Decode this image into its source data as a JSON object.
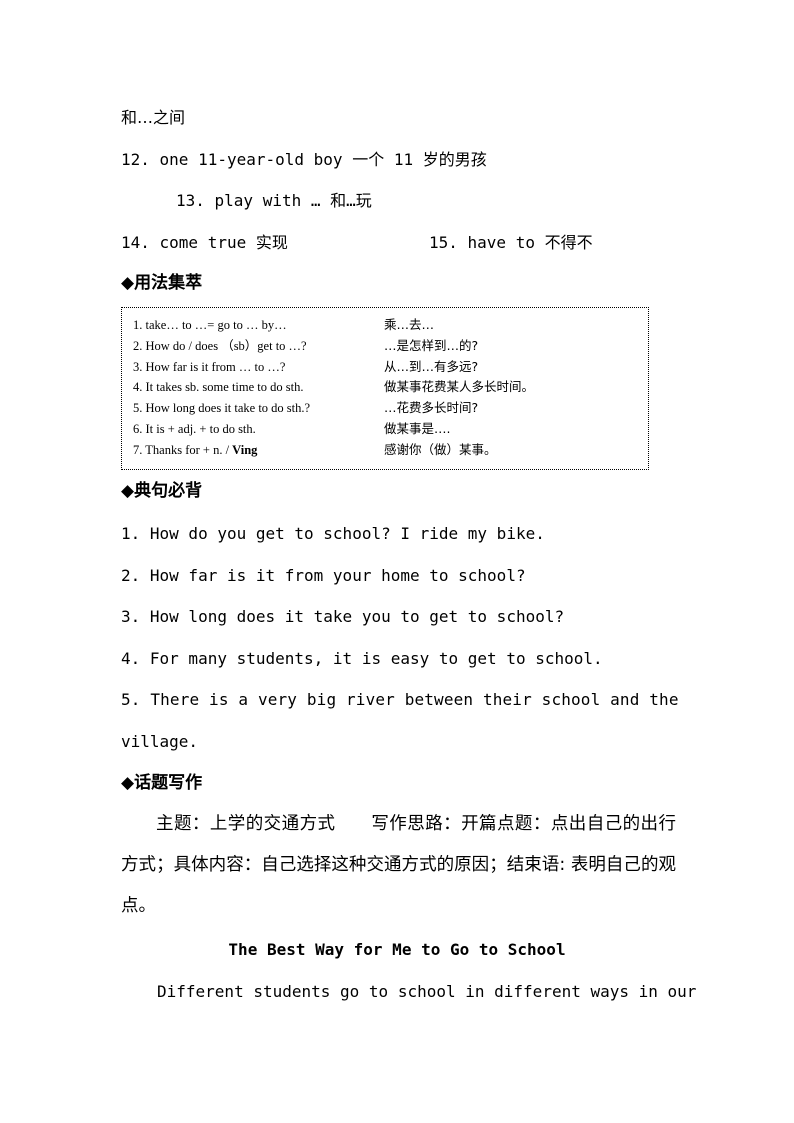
{
  "phrases": {
    "continuation": "和…之间",
    "item12": "12. one 11-year-old boy 一个 11 岁的男孩",
    "item13": "13. play with … 和…玩",
    "item14": "14. come true 实现",
    "item15": "15. have to 不得不"
  },
  "usage_section": {
    "heading": "◆用法集萃",
    "rows": [
      {
        "en": "1. take… to …= go to … by…",
        "en_bold": "",
        "zh": "乘…去…"
      },
      {
        "en": "2. How do / does （sb）get to …?",
        "en_bold": "",
        "zh": "…是怎样到…的?"
      },
      {
        "en": "3. How far is it from … to …?",
        "en_bold": "",
        "zh": "从…到…有多远?"
      },
      {
        "en": "4. It takes sb. some time to do sth.",
        "en_bold": "",
        "zh": "做某事花费某人多长时间。"
      },
      {
        "en": "5. How long does it take to do sth.?",
        "en_bold": "",
        "zh": "…花费多长时间?"
      },
      {
        "en": "6. It is + adj. + to do sth.",
        "en_bold": "",
        "zh": "做某事是…."
      },
      {
        "en": "7. Thanks for + n. / ",
        "en_bold": "Ving",
        "zh": "感谢你（做）某事。"
      }
    ]
  },
  "sentences_section": {
    "heading": "◆典句必背",
    "items": [
      "1. How do you get to school?  I ride my bike.",
      "2. How far is it from your home to school?",
      "3. How long does it take you to get to school?",
      "4. For many students, it is easy to get to school.",
      "5. There is a very big river between their school and the",
      "village."
    ]
  },
  "writing_section": {
    "heading": "◆话题写作",
    "instructions": "主题：上学的交通方式　　写作思路：开篇点题：点出自己的出行方式；具体内容：自己选择这种交通方式的原因；结束语: 表明自己的观点。",
    "essay_title": "The Best Way for Me to Go to School",
    "essay_first_line": "Different students go to school in different ways in our"
  }
}
